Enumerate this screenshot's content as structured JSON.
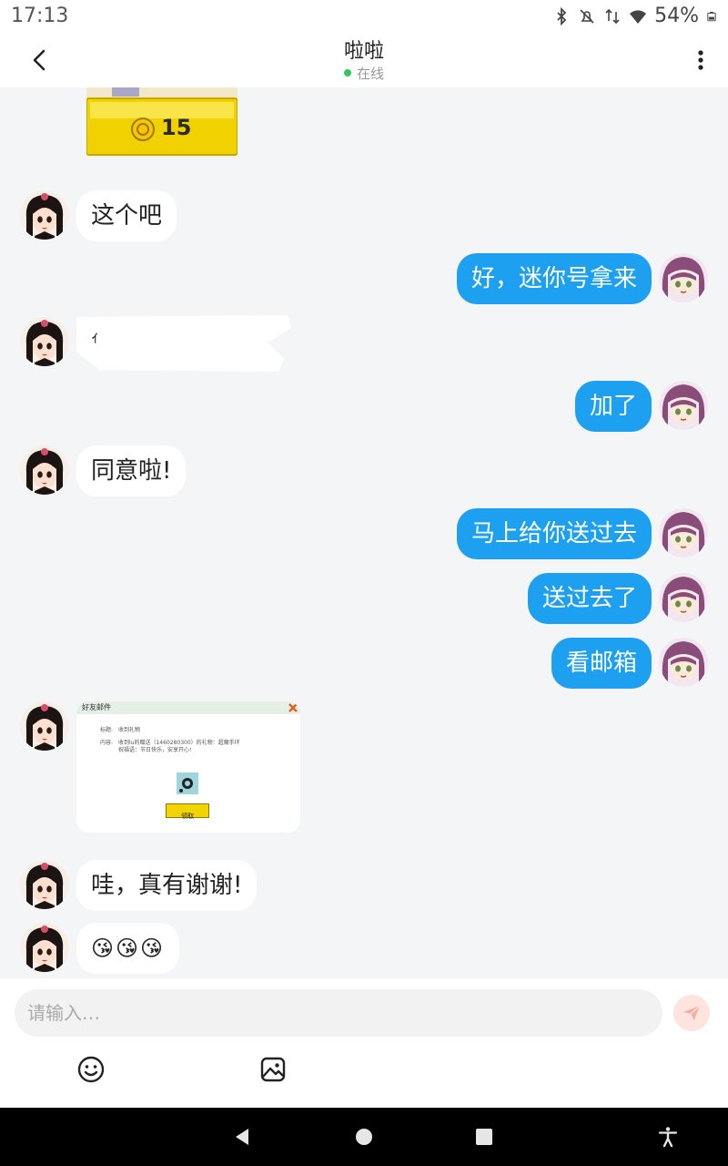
{
  "status_bar": {
    "time": "17:13",
    "battery": "54%"
  },
  "header": {
    "title": "啦啦",
    "status": "在线"
  },
  "coin_card": {
    "amount": "15"
  },
  "messages": [
    {
      "side": "in",
      "text": "这个吧"
    },
    {
      "side": "out",
      "text": "好，迷你号拿来"
    },
    {
      "side": "in",
      "text": "ｨ"
    },
    {
      "side": "out",
      "text": "加了"
    },
    {
      "side": "in",
      "text": "同意啦!"
    },
    {
      "side": "out",
      "text": "马上给你送过去"
    },
    {
      "side": "out",
      "text": "送过去了"
    },
    {
      "side": "out",
      "text": "看邮箱"
    },
    {
      "side": "in",
      "text": "哇，真有谢谢!"
    },
    {
      "side": "in",
      "text": "😘😘😘"
    }
  ],
  "mail_card": {
    "title": "好友邮件",
    "subject_label": "标题:",
    "subject": "收到礼物",
    "content_label": "内容:",
    "content_line1": "收到lu的赠送（1460280300）的礼物：超魔手环",
    "content_line2": "祝福语：节日快乐，安享开心!",
    "claim_label": "领取"
  },
  "input": {
    "placeholder": "请输入…"
  },
  "icons": {
    "back": "back-arrow-icon",
    "more": "more-vertical-icon",
    "send": "send-icon",
    "emoji": "emoji-icon",
    "image": "image-icon"
  }
}
